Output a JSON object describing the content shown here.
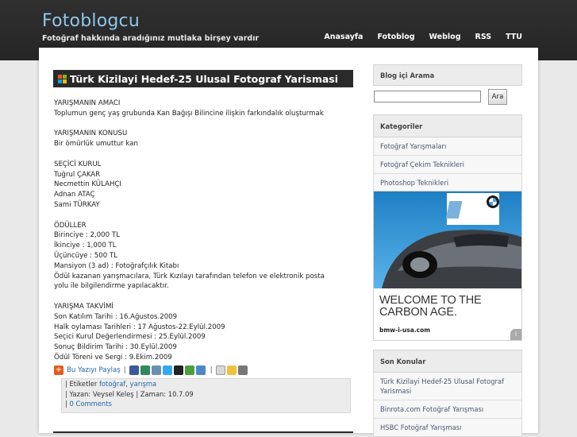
{
  "header": {
    "site_title": "Fotoblogcu",
    "tagline": "Fotoğraf hakkında aradığınız mutlaka birşey vardır",
    "nav": [
      "Anasayfa",
      "Fotoblog",
      "Weblog",
      "RSS",
      "TTU"
    ]
  },
  "post": {
    "title": "Türk Kizilayi Hedef-25 Ulusal Fotograf Yarismasi",
    "body_lines": [
      "YARIŞMANIN AMACI",
      "Toplumun genç yaş grubunda Kan Bağışı Bilincine ilişkin farkındalık oluşturmak",
      "",
      "YARIŞMANIN KONUSU",
      "Bir ömürlük umuttur kan",
      "",
      "SEÇİCİ KURUL",
      "Tuğrul ÇAKAR",
      "Necmettin KÜLAHÇI",
      "Adnan ATAÇ",
      "Sami TÜRKAY",
      "",
      "ÖDÜLLER",
      "Birinciye : 2,000 TL",
      "İkinciye : 1,000 TL",
      "Üçüncüye : 500 TL",
      "Mansiyon (3 ad) : Fotoğrafçılık Kitabı",
      "Ödül kazanan yarışmacılara, Türk Kızılayı tarafından telefon ve elektronik posta",
      "yolu ile bilgilendirme yapılacaktır.",
      "",
      "YARIŞMA TAKVİMİ",
      "Son Katılım Tarihi : 16.Ağustos.2009",
      "Halk oylaması Tarihleri : 17 Ağustos-22.Eylül.2009",
      "Seçici Kurul Değerlendirmesi : 25.Eylül.2009",
      "Sonuç Bildirim Tarihi : 30.Eylül.2009",
      "Ödül Töreni ve Sergi : 9.Ekim.2009"
    ],
    "share_label": "Bu Yazıyı Paylaş",
    "meta": {
      "tags_prefix": "| Etiketler",
      "tag1": "fotoğraf",
      "tag2": "yarışma",
      "author_line": "| Yazan: Veysel Keleş | Zaman: 10.7.09",
      "comments_prefix": "|",
      "comments": "0 Comments"
    }
  },
  "sidebar": {
    "search_title": "Blog içi Arama",
    "search_placeholder": "",
    "search_button": "Ara",
    "categories_title": "Kategoriler",
    "categories": [
      "Fotoğraf Yarışmaları",
      "Fotoğraf Çekim Teknikleri",
      "Photoshop Teknikleri"
    ],
    "ad_headline_1": "WELCOME TO THE",
    "ad_headline_2": "CARBON AGE.",
    "ad_url": "bmw-i-usa.com",
    "recent_title": "Son Konular",
    "recent": [
      "Türk Kizilayi Hedef-25 Ulusal Fotograf Yarismasi",
      "Binrota.com Fotoğraf Yarışması",
      "HSBC Fotoğraf Yarışması"
    ]
  },
  "colors": {
    "header_bg": "#2a2a2a",
    "title_blue": "#8fc6ea",
    "link": "#2266aa"
  }
}
